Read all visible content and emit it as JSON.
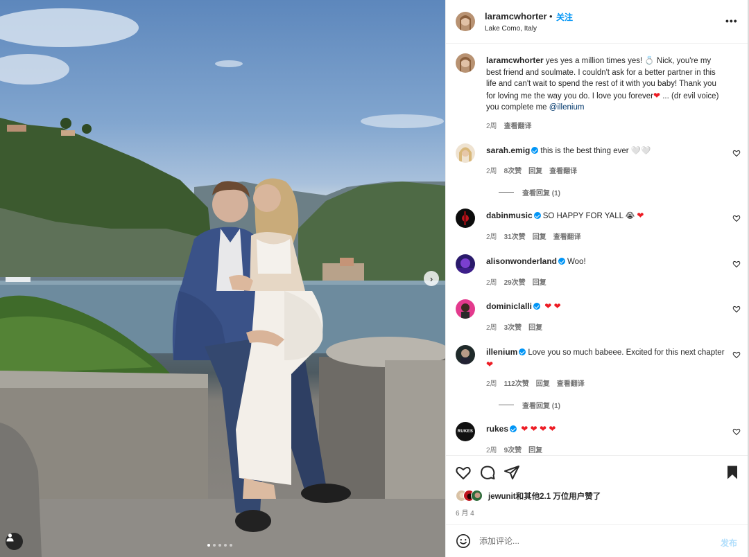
{
  "post": {
    "username": "laramcwhorter",
    "separator": "•",
    "follow_label": "关注",
    "location": "Lake Como, Italy",
    "more_icon": "more-horizontal-icon"
  },
  "caption": {
    "username": "laramcwhorter",
    "text_before": " yes yes a million times yes! 💍 Nick, you're my best friend and soulmate. I couldn't ask for a better partner in this life and can't wait to spend the rest of it with you baby! Thank you for loving me the way you do. I love you forever",
    "text_after": " ... (dr evil voice) you complete me ",
    "mention": "@illenium",
    "time": "2周",
    "translate": "查看翻译"
  },
  "comments": [
    {
      "username": "sarah.emig",
      "verified": true,
      "text": "this is the best thing ever 🤍🤍",
      "time": "2周",
      "likes": "8次赞",
      "reply": "回复",
      "translate": "查看翻译",
      "view_replies": "查看回复 (1)"
    },
    {
      "username": "dabinmusic",
      "verified": true,
      "text": "SO HAPPY FOR YALL 😭",
      "time": "2周",
      "likes": "31次赞",
      "reply": "回复",
      "translate": "查看翻译"
    },
    {
      "username": "alisonwonderland",
      "verified": true,
      "text": "Woo!",
      "time": "2周",
      "likes": "29次赞",
      "reply": "回复"
    },
    {
      "username": "dominiclalli",
      "verified": true,
      "text": "",
      "time": "2周",
      "likes": "3次赞",
      "reply": "回复"
    },
    {
      "username": "illenium",
      "verified": true,
      "text": "Love you so much babeee. Excited for this next chapter",
      "time": "2周",
      "likes": "112次赞",
      "reply": "回复",
      "translate": "查看翻译",
      "view_replies": "查看回复 (1)"
    },
    {
      "username": "rukes",
      "verified": true,
      "text": "",
      "time": "2周",
      "likes": "9次赞",
      "reply": "回复",
      "avatar_text": "RUKES"
    }
  ],
  "actions": {
    "like_icon": "heart-outline-icon",
    "comment_icon": "comment-icon",
    "share_icon": "share-send-icon",
    "save_icon": "bookmark-filled-icon"
  },
  "likes": {
    "user": "jewunit",
    "rest": "和其他2.1 万位用户赞了"
  },
  "date": "6 月 4",
  "add_comment": {
    "placeholder": "添加评论...",
    "post_label": "发布"
  },
  "colors": {
    "accent": "#0095f6",
    "heart": "#ed1c24",
    "post_disabled": "#b2dffc"
  }
}
